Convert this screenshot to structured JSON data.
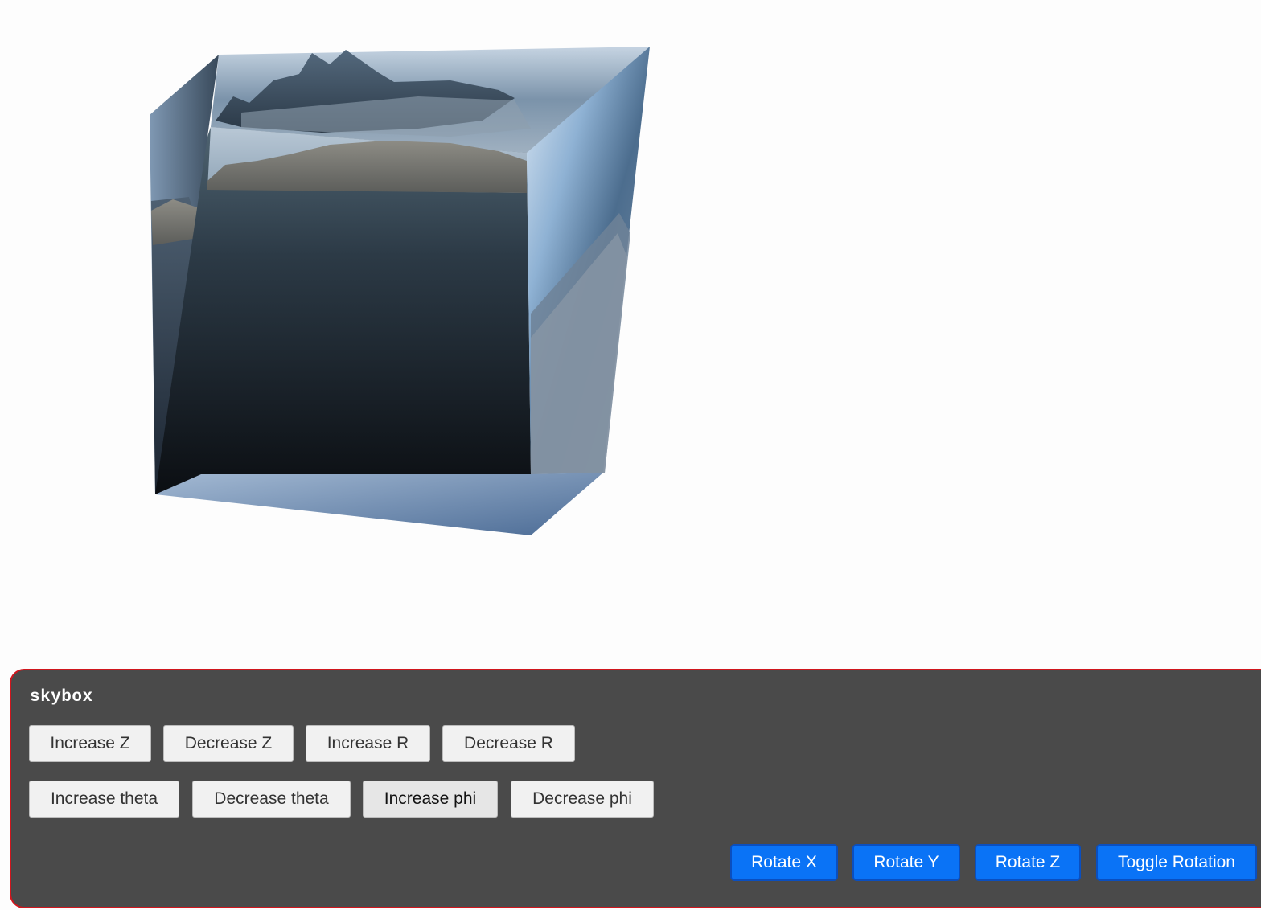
{
  "panel": {
    "title": "skybox",
    "row1": [
      {
        "label": "Increase Z"
      },
      {
        "label": "Decrease Z"
      },
      {
        "label": "Increase R"
      },
      {
        "label": "Decrease R"
      }
    ],
    "row2": [
      {
        "label": "Increase theta"
      },
      {
        "label": "Decrease theta"
      },
      {
        "label": "Increase phi"
      },
      {
        "label": "Decrease phi"
      }
    ],
    "rotate": [
      {
        "label": "Rotate X"
      },
      {
        "label": "Rotate Y"
      },
      {
        "label": "Rotate Z"
      },
      {
        "label": "Toggle Rotation"
      }
    ]
  },
  "colors": {
    "panel_bg": "#4a4a4a",
    "panel_border": "#d0161d",
    "accent_button": "#0a73f6"
  }
}
